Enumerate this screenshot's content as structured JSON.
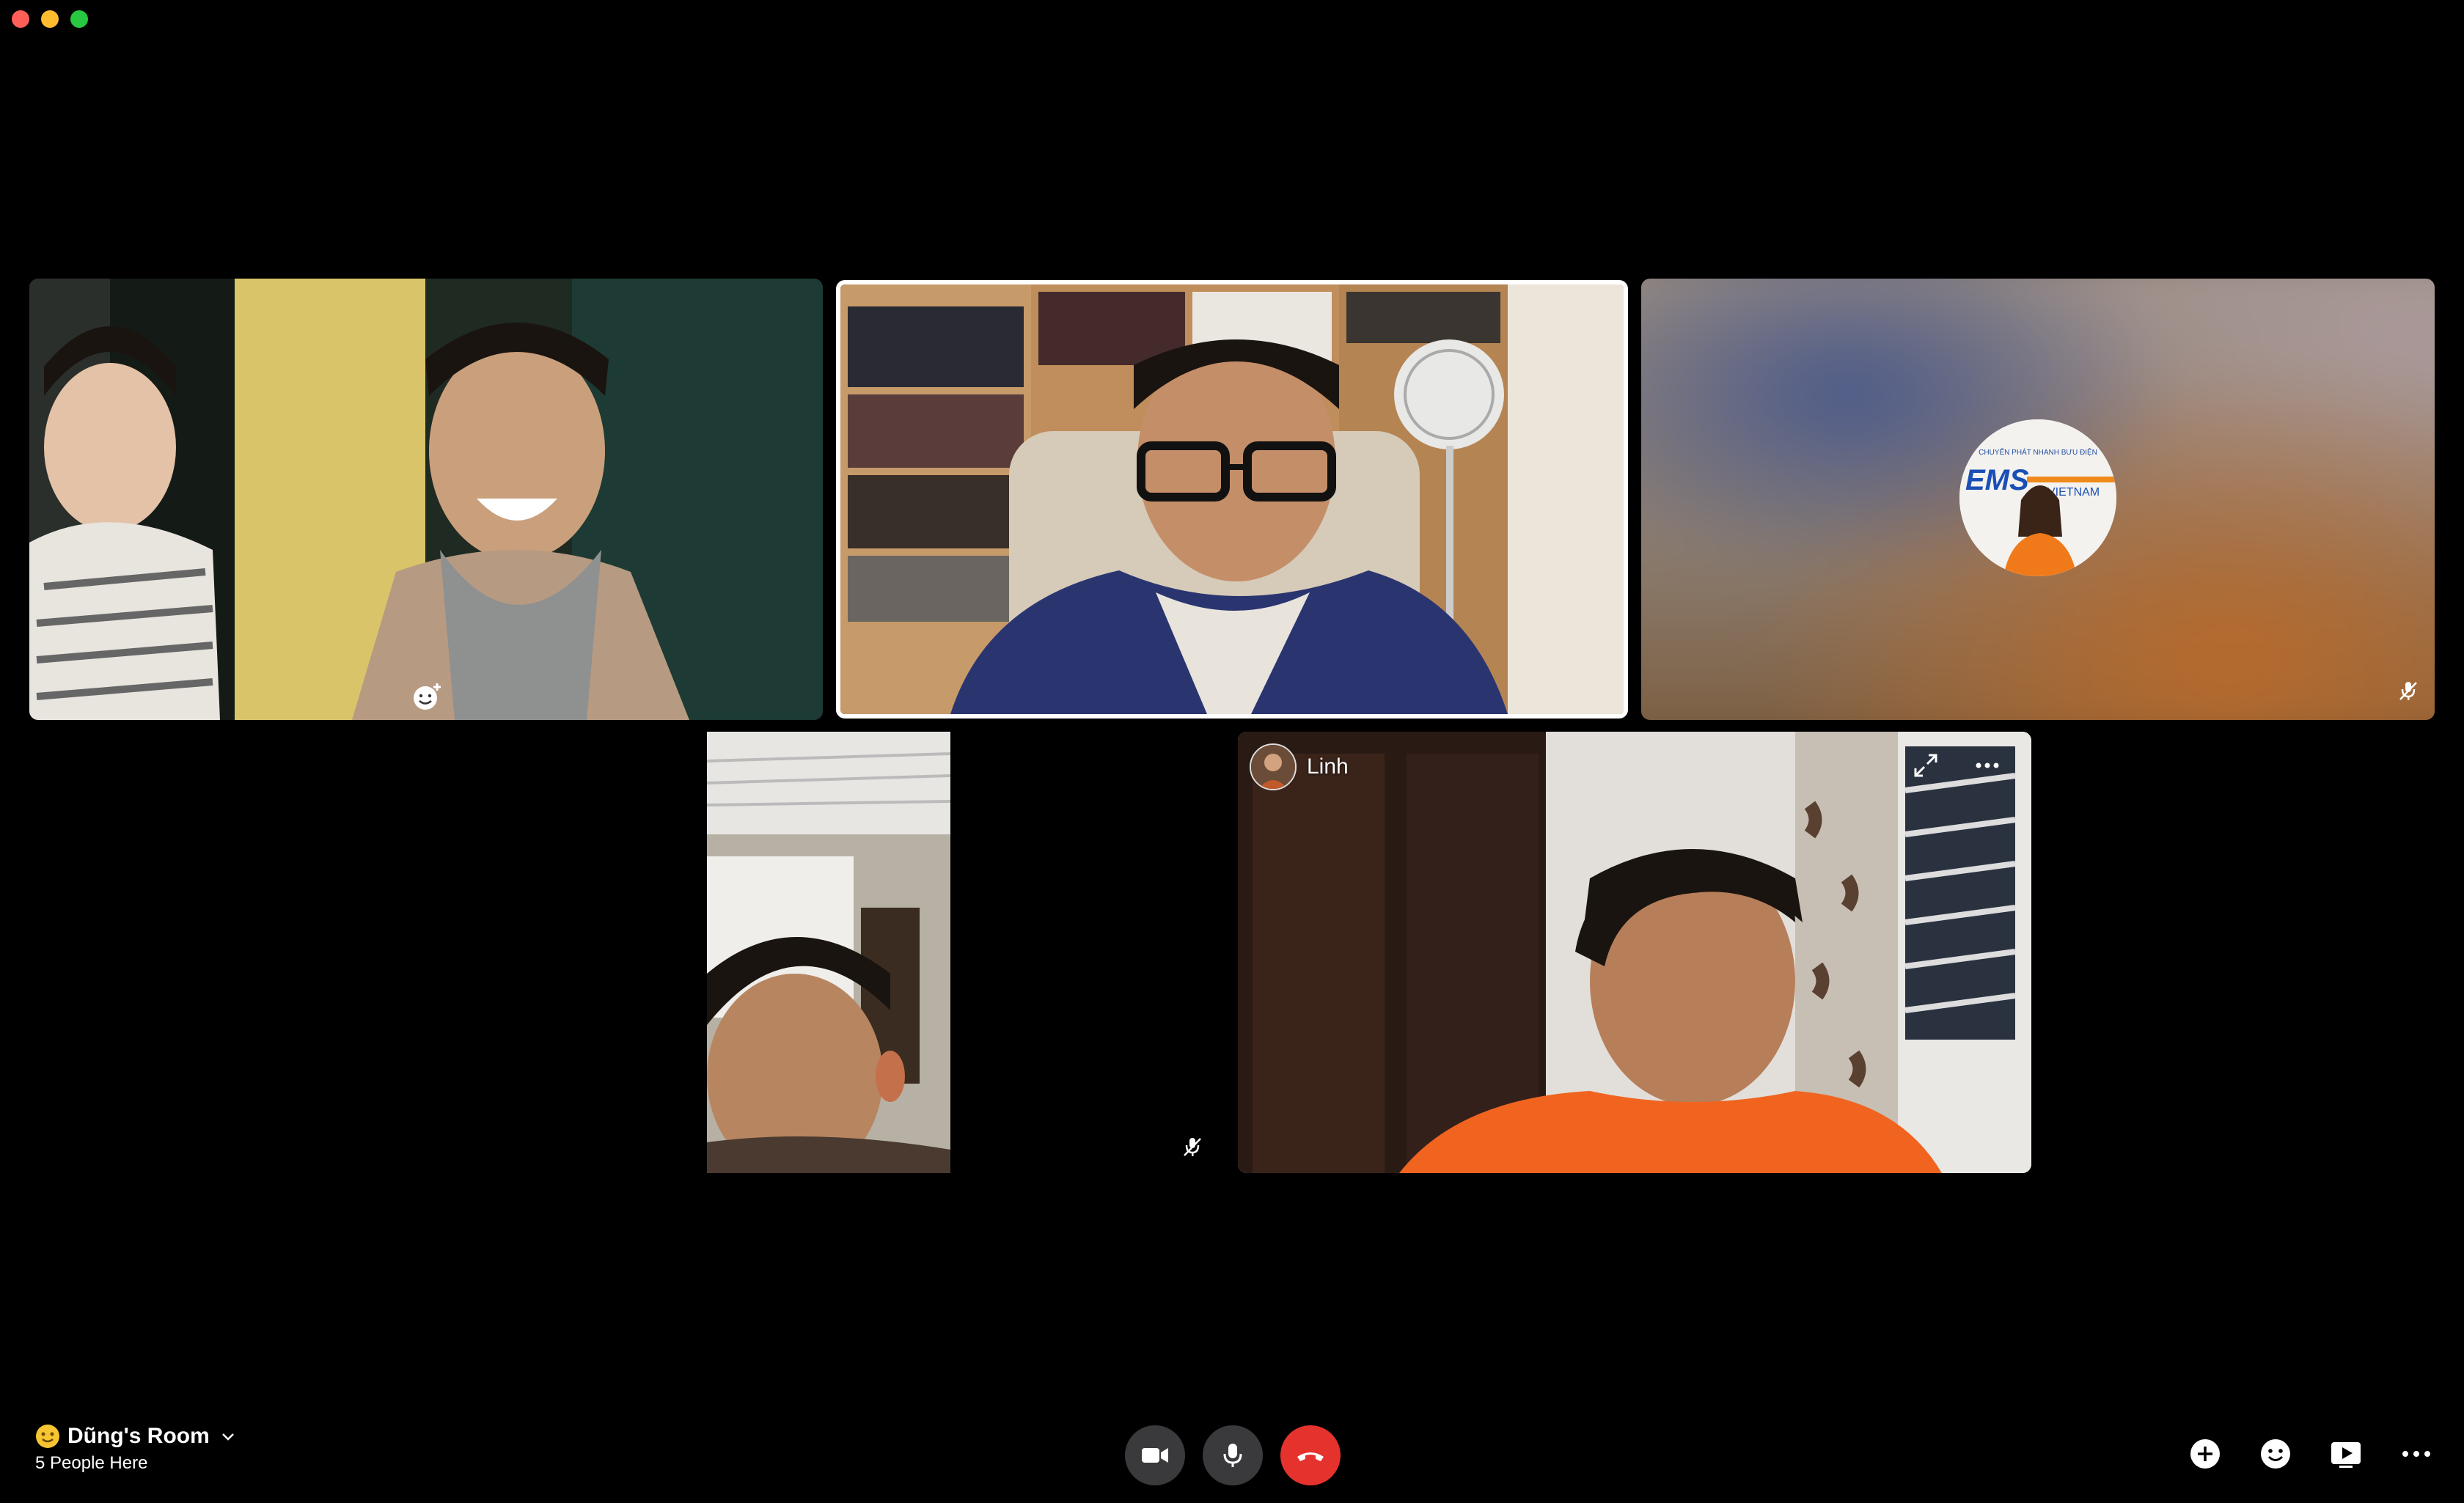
{
  "window": {
    "traffic_lights": [
      "close",
      "minimize",
      "maximize"
    ]
  },
  "participants": [
    {
      "id": "tile1",
      "muted": false,
      "reaction_icon": "add-reaction-icon",
      "active_speaker": false
    },
    {
      "id": "tile2",
      "muted": false,
      "active_speaker": true
    },
    {
      "id": "tile3",
      "muted": true,
      "video": false,
      "avatar_text": [
        "CHUYỂN PHÁT NHANH BƯU ĐIỆN",
        "EMS",
        "VIETNAM"
      ]
    },
    {
      "id": "tile4",
      "muted": true,
      "active_speaker": false
    },
    {
      "id": "tile5",
      "name": "Linh",
      "muted": false,
      "controls": [
        "expand-icon",
        "more-options-icon"
      ]
    }
  ],
  "room": {
    "emoji_icon": "smiley-face-icon",
    "title": "Dũng's Room",
    "count": "5 People Here"
  },
  "call_controls": [
    "camera-icon",
    "microphone-icon",
    "end-call-icon"
  ],
  "right_controls": [
    "add-people-icon",
    "emoji-reaction-icon",
    "share-screen-icon",
    "more-options-icon"
  ],
  "colors": {
    "background": "#000000",
    "active_border": "#ffffff",
    "end_call": "#e5322d",
    "control_bg": "#3a3a3c"
  }
}
